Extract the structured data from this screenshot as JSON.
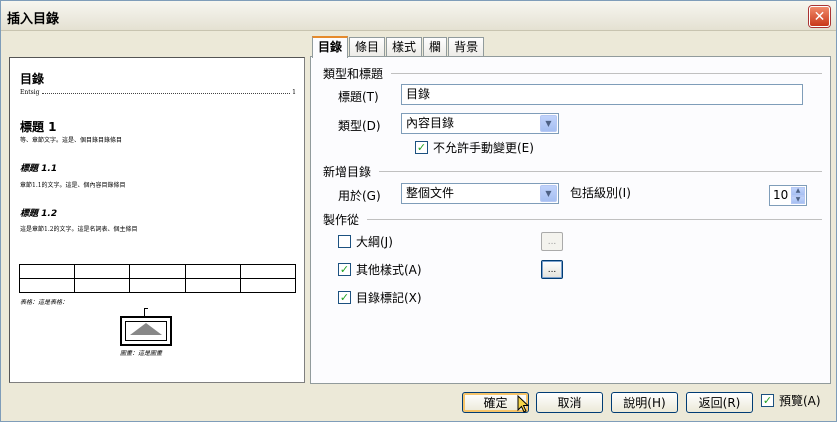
{
  "window": {
    "title": "插入目錄",
    "close_symbol": "✕"
  },
  "preview": {
    "toc_title": "目錄",
    "entry_text": "Entsig",
    "entry_page": "1",
    "heading1": "標題 1",
    "heading1_body": "等、章節文字。這是、個目錄目錄條目",
    "heading2a": "標題 1.1",
    "heading2a_body": "章節1.1的文字。這是、個內容目錄條目",
    "heading2b": "標題 1.2",
    "heading2b_body": "這是章節1.2的文字。這是名詞表、個主條目",
    "table_caption": "表格：這是表格：",
    "image_caption": "圖畫：這是圖畫"
  },
  "tabs": [
    {
      "label": "目錄",
      "active": true
    },
    {
      "label": "條目",
      "active": false
    },
    {
      "label": "樣式",
      "active": false
    },
    {
      "label": "欄",
      "active": false
    },
    {
      "label": "背景",
      "active": false
    }
  ],
  "type_section": {
    "heading": "類型和標題",
    "title_label": "標題(T)",
    "title_value": "目錄",
    "type_label": "類型(D)",
    "type_value": "內容目錄",
    "protect_label": "不允許手動變更(E)",
    "protect_checked": true
  },
  "create_section": {
    "heading": "新增目錄",
    "for_label": "用於(G)",
    "for_value": "整個文件",
    "levels_label": "包括級別(I)",
    "levels_value": "10"
  },
  "from_section": {
    "heading": "製作從",
    "outline_label": "大綱(J)",
    "outline_checked": false,
    "styles_label": "其他樣式(A)",
    "styles_checked": true,
    "marks_label": "目錄標記(X)",
    "marks_checked": true,
    "dots": "..."
  },
  "buttons": {
    "ok": "確定",
    "cancel": "取消",
    "help": "說明(H)",
    "reset": "返回(R)",
    "preview_label": "預覽(A)",
    "preview_checked": true
  },
  "check_mark": "✓",
  "arrow_down": "▼",
  "arrow_up": "▲"
}
